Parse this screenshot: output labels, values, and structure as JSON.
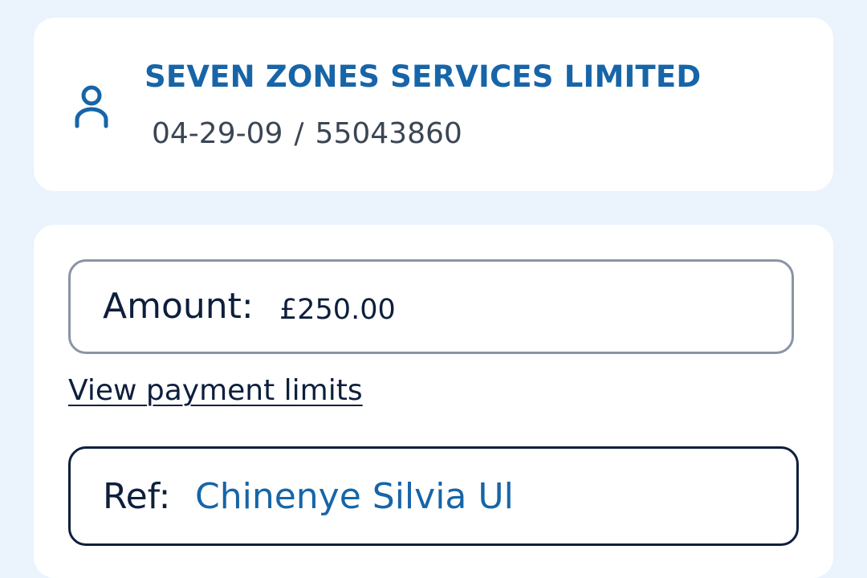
{
  "payee": {
    "icon": "person-icon",
    "name": "SEVEN ZONES SERVICES LIMITED",
    "sort_code": "04-29-09",
    "separator": "/",
    "account_number": "55043860"
  },
  "payment_form": {
    "amount": {
      "label": "Amount:",
      "value": "£250.00"
    },
    "limits_link": "View payment limits",
    "reference": {
      "label": "Ref:",
      "value": "Chinenye Silvia Ul"
    }
  },
  "colors": {
    "background": "#ebf3fd",
    "accent": "#1765a8",
    "text_dark": "#0d1f3c",
    "border_muted": "#8a94a3"
  }
}
